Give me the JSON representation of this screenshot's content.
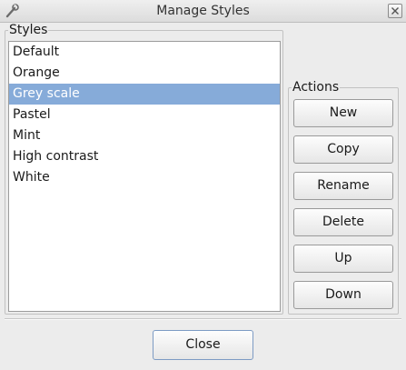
{
  "window": {
    "title": "Manage Styles",
    "close_button_label": "✕"
  },
  "styles_group": {
    "label": "Styles",
    "items": [
      {
        "label": "Default"
      },
      {
        "label": "Orange"
      },
      {
        "label": "Grey scale",
        "selected": true
      },
      {
        "label": "Pastel"
      },
      {
        "label": "Mint"
      },
      {
        "label": "High contrast"
      },
      {
        "label": "White"
      }
    ]
  },
  "actions_group": {
    "label": "Actions",
    "buttons": {
      "new": "New",
      "copy": "Copy",
      "rename": "Rename",
      "delete": "Delete",
      "up": "Up",
      "down": "Down"
    }
  },
  "footer": {
    "close_label": "Close"
  },
  "colors": {
    "selection": "#86abd9",
    "selection_text": "#ffffff",
    "window_bg": "#ececec"
  },
  "icons": {
    "app_icon": "wrench-brush-icon",
    "window_close": "close-icon"
  }
}
